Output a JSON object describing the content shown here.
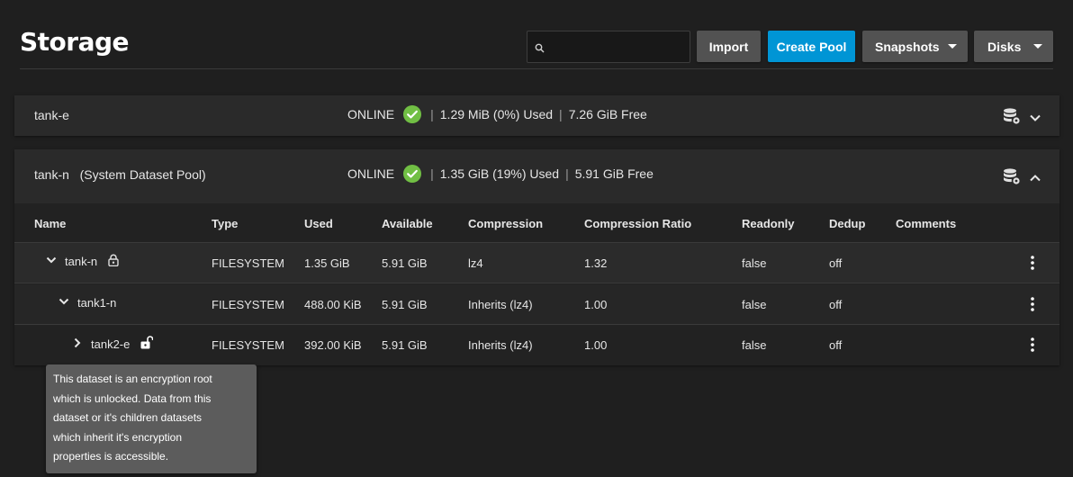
{
  "header": {
    "title": "Storage",
    "search": {
      "placeholder": "",
      "value": ""
    },
    "buttons": {
      "import": "Import",
      "create_pool": "Create Pool",
      "snapshots": "Snapshots",
      "disks": "Disks"
    }
  },
  "colors": {
    "accent": "#0095d5",
    "ok": "#71bf44",
    "background": "#1f1f1f",
    "card": "#2a2a2a",
    "tooltip": "#5c5c5c"
  },
  "icons": {
    "search": "search-icon",
    "status_ok": "check-circle-icon",
    "pool_settings": "database-gear-icon",
    "expand": "chevron-down-icon",
    "collapse": "chevron-up-icon",
    "row_menu": "more-vert-icon",
    "locked": "lock-icon",
    "unlocked": "lock-open-icon"
  },
  "pools": [
    {
      "name": "tank-e",
      "status": "ONLINE",
      "used": "1.29 MiB (0%) Used",
      "free": "7.26 GiB Free",
      "expanded": false
    },
    {
      "name": "tank-n",
      "subtitle": "(System Dataset Pool)",
      "status": "ONLINE",
      "used": "1.35 GiB (19%) Used",
      "free": "5.91 GiB Free",
      "expanded": true,
      "columns": [
        "Name",
        "Type",
        "Used",
        "Available",
        "Compression",
        "Compression Ratio",
        "Readonly",
        "Dedup",
        "Comments"
      ],
      "datasets": [
        {
          "name": "tank-n",
          "type": "FILESYSTEM",
          "used": "1.35 GiB",
          "available": "5.91 GiB",
          "compression": "lz4",
          "ratio": "1.32",
          "readonly": "false",
          "dedup": "off",
          "comments": ""
        },
        {
          "name": "tank1-n",
          "type": "FILESYSTEM",
          "used": "488.00 KiB",
          "available": "5.91 GiB",
          "compression": "Inherits (lz4)",
          "ratio": "1.00",
          "readonly": "false",
          "dedup": "off",
          "comments": ""
        },
        {
          "name": "tank2-e",
          "type": "FILESYSTEM",
          "used": "392.00 KiB",
          "available": "5.91 GiB",
          "compression": "Inherits (lz4)",
          "ratio": "1.00",
          "readonly": "false",
          "dedup": "off",
          "comments": ""
        }
      ]
    }
  ],
  "tooltip": {
    "lines": [
      "This dataset is an encryption root",
      "which is unlocked. Data from this",
      "dataset or it's children datasets",
      "which inherit it's encryption",
      "properties is accessible."
    ]
  }
}
